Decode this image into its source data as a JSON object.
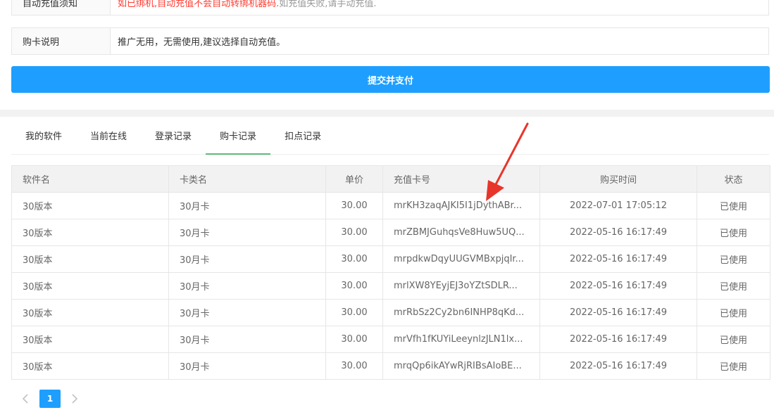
{
  "notice": {
    "label": "自动充值须知",
    "text_red": "如已绑机,自动充值不会自动转绑机器码.",
    "text_gray": "如充值失败,请手动充值."
  },
  "description": {
    "label": "购卡说明",
    "text": "推广无用，无需使用,建议选择自动充值。"
  },
  "submit_label": "提交并支付",
  "tabs": [
    {
      "label": "我的软件",
      "active": false
    },
    {
      "label": "当前在线",
      "active": false
    },
    {
      "label": "登录记录",
      "active": false
    },
    {
      "label": "购卡记录",
      "active": true
    },
    {
      "label": "扣点记录",
      "active": false
    }
  ],
  "table": {
    "headers": [
      "软件名",
      "卡类名",
      "单价",
      "充值卡号",
      "购买时间",
      "状态"
    ],
    "rows": [
      [
        "30版本",
        "30月卡",
        "30.00",
        "mrKH3zaqAJKI5I1jDythABr...",
        "2022-07-01 17:05:12",
        "已使用"
      ],
      [
        "30版本",
        "30月卡",
        "30.00",
        "mrZBMJGuhqsVe8Huw5UQ...",
        "2022-05-16 16:17:49",
        "已使用"
      ],
      [
        "30版本",
        "30月卡",
        "30.00",
        "mrpdkwDqyUUGVMBxpjqIr...",
        "2022-05-16 16:17:49",
        "已使用"
      ],
      [
        "30版本",
        "30月卡",
        "30.00",
        "mrlXW8YEyjEJ3oYZtSDLR...",
        "2022-05-16 16:17:49",
        "已使用"
      ],
      [
        "30版本",
        "30月卡",
        "30.00",
        "mrRbSz2Cy2bn6INHP8qKd...",
        "2022-05-16 16:17:49",
        "已使用"
      ],
      [
        "30版本",
        "30月卡",
        "30.00",
        "mrVfh1fKUYiLeeynlzJLN1lx...",
        "2022-05-16 16:17:49",
        "已使用"
      ],
      [
        "30版本",
        "30月卡",
        "30.00",
        "mrqQp6ikAYwRjRIBsAIoBE...",
        "2022-05-16 16:17:49",
        "已使用"
      ]
    ]
  },
  "pagination": {
    "current_page": "1",
    "prev_icon": "chevron-left-icon",
    "next_icon": "chevron-right-icon"
  },
  "colors": {
    "primary": "#1e9fff",
    "tab_active": "#5fb878",
    "annotation": "#e8352b",
    "notice_red": "#ff3b30"
  }
}
